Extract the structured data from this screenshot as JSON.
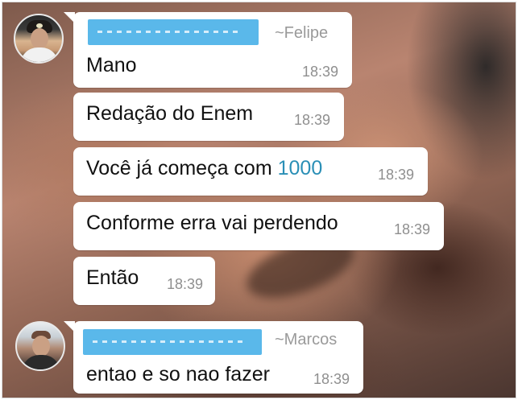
{
  "conversation": {
    "messages": [
      {
        "sender": "~Felipe",
        "text": "Mano",
        "time": "18:39"
      },
      {
        "text": "Redação do Enem",
        "time": "18:39"
      },
      {
        "text_before": "Você já começa com ",
        "text_highlight": "1000",
        "time": "18:39"
      },
      {
        "text": "Conforme erra vai perdendo",
        "time": "18:39"
      },
      {
        "text": "Então",
        "time": "18:39"
      },
      {
        "sender": "~Marcos",
        "text": "entao e so nao fazer",
        "time": "18:39"
      }
    ]
  },
  "colors": {
    "bubble": "#ffffff",
    "redaction": "#5ab8ea",
    "highlight_number": "#2a8fb6",
    "timestamp": "#8f8f8f"
  }
}
